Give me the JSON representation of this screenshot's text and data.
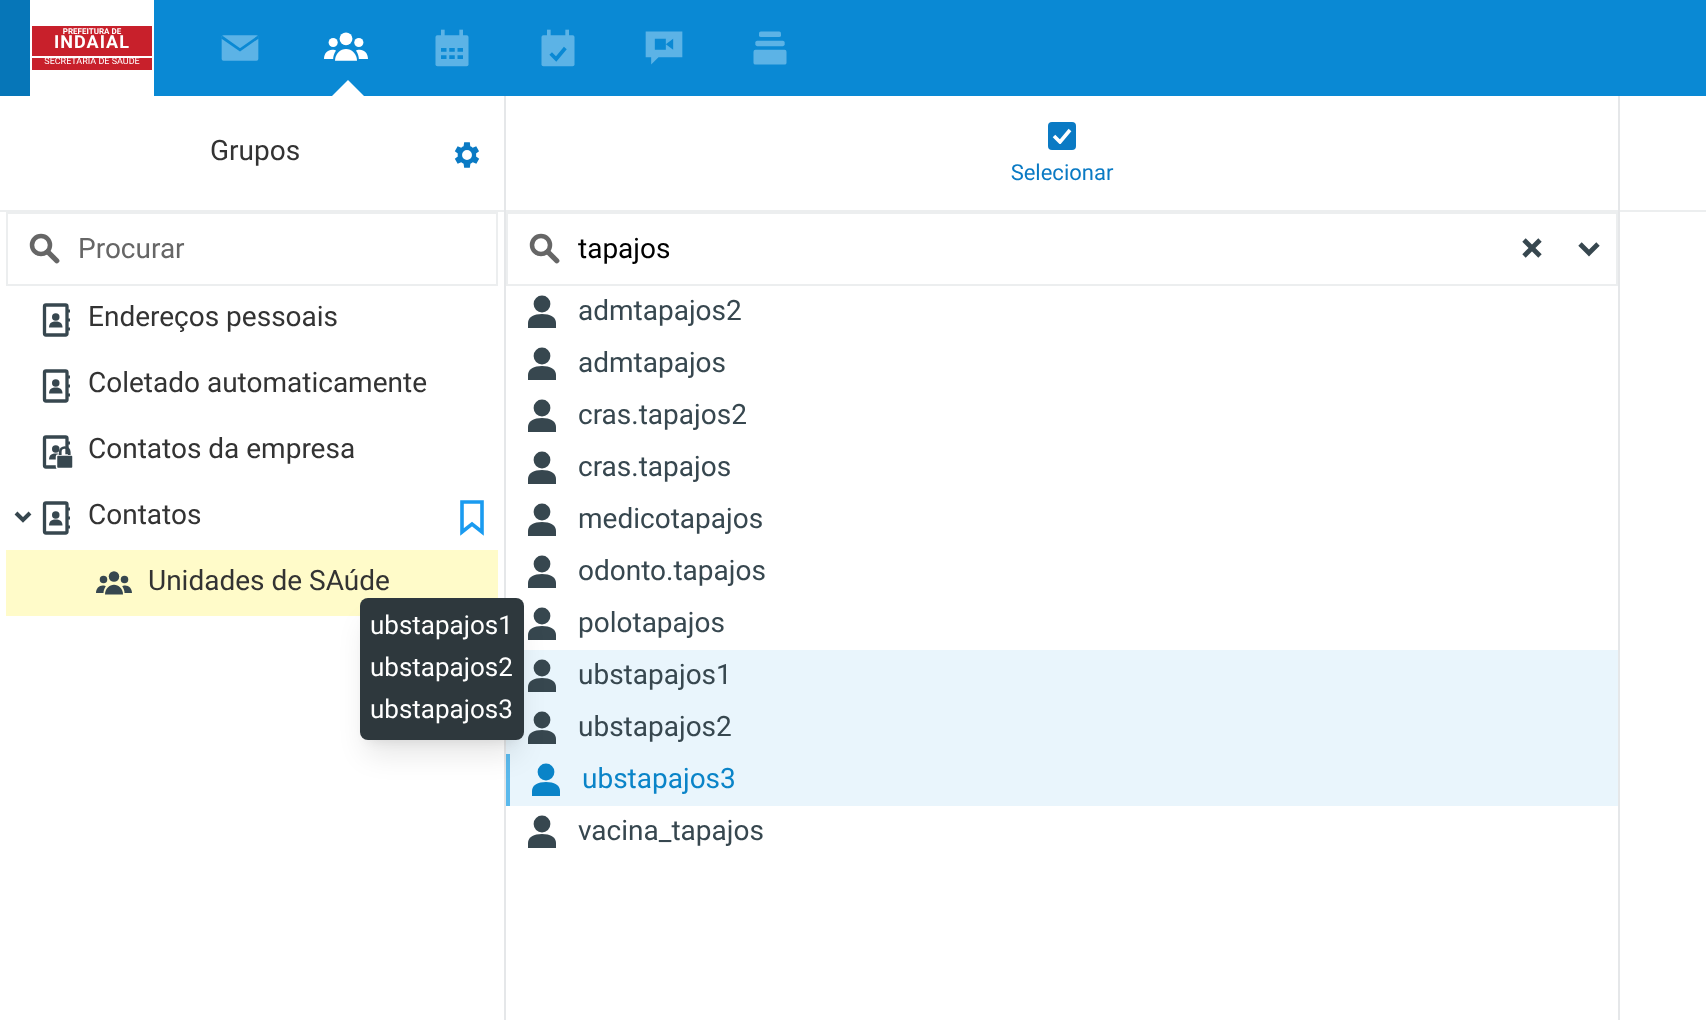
{
  "logo": {
    "lines": [
      "PREFEITURA DE",
      "INDAIAL",
      "SECRETARIA DE SAÚDE"
    ]
  },
  "nav": [
    {
      "selected": false
    },
    {
      "selected": true
    },
    {
      "selected": false
    },
    {
      "selected": false
    },
    {
      "selected": false
    },
    {
      "selected": false
    }
  ],
  "sidebar": {
    "title": "Grupos",
    "search": {
      "placeholder": "Procurar"
    },
    "items": [
      {
        "label": "Endereços pessoais",
        "selected": false
      },
      {
        "label": "Coletado automaticamente",
        "selected": false
      },
      {
        "label": "Contatos da empresa",
        "selected": false
      },
      {
        "label": "Contatos",
        "selected": false,
        "expanded": true,
        "bookmark": true,
        "children": [
          {
            "label": "Unidades de SAúde",
            "selected": true
          }
        ]
      }
    ]
  },
  "toolbar": {
    "select_label": "Selecionar",
    "select_checked": true
  },
  "list": {
    "search": {
      "value": "tapajos"
    },
    "contacts": [
      {
        "name": "admtapajos2",
        "selected": false,
        "focused": false
      },
      {
        "name": "admtapajos",
        "selected": false,
        "focused": false
      },
      {
        "name": "cras.tapajos2",
        "selected": false,
        "focused": false
      },
      {
        "name": "cras.tapajos",
        "selected": false,
        "focused": false
      },
      {
        "name": "medicotapajos",
        "selected": false,
        "focused": false
      },
      {
        "name": "odonto.tapajos",
        "selected": false,
        "focused": false
      },
      {
        "name": "polotapajos",
        "selected": false,
        "focused": false
      },
      {
        "name": "ubstapajos1",
        "selected": true,
        "focused": false
      },
      {
        "name": "ubstapajos2",
        "selected": true,
        "focused": false
      },
      {
        "name": "ubstapajos3",
        "selected": true,
        "focused": true
      },
      {
        "name": "vacina_tapajos",
        "selected": false,
        "focused": false
      }
    ]
  },
  "tooltip": {
    "lines": [
      "ubstapajos1",
      "ubstapajos2",
      "ubstapajos3"
    ]
  }
}
